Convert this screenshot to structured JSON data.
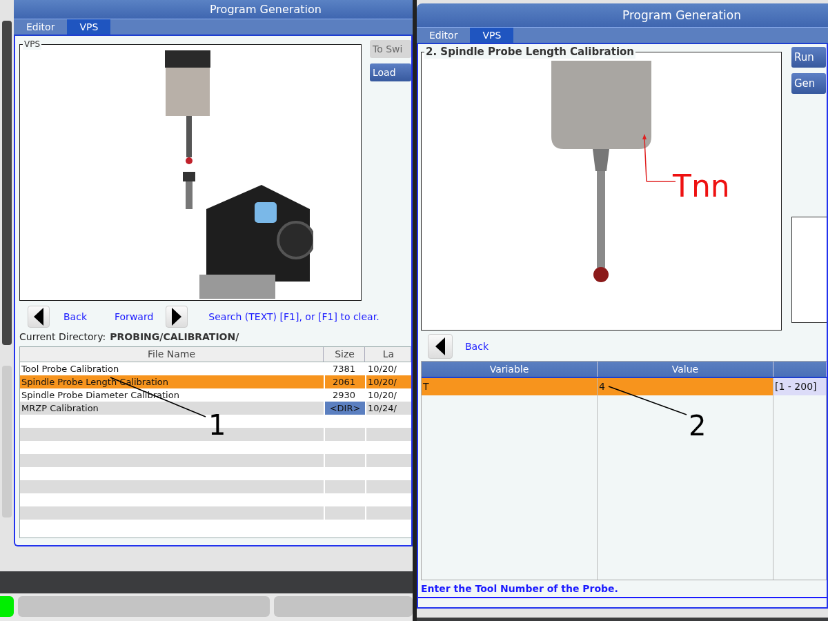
{
  "left": {
    "title": "Program Generation",
    "tabs": [
      {
        "label": "Editor",
        "selected": false
      },
      {
        "label": "VPS",
        "selected": true
      }
    ],
    "group_title": "VPS",
    "side_buttons": [
      {
        "label": "To Swi",
        "disabled": true
      },
      {
        "label": "Load",
        "disabled": false
      }
    ],
    "nav": {
      "back": "Back",
      "forward": "Forward",
      "hint": "Search (TEXT) [F1], or [F1] to clear."
    },
    "current_directory": {
      "label": "Current Directory:",
      "path": "PROBING/CALIBRATION/"
    },
    "table": {
      "columns": [
        "File Name",
        "Size",
        "La"
      ],
      "rows": [
        {
          "name": "Tool Probe Calibration",
          "size": "7381",
          "date": "10/20/",
          "kind": "file",
          "selected": false
        },
        {
          "name": "Spindle Probe Length Calibration",
          "size": "2061",
          "date": "10/20/",
          "kind": "file",
          "selected": true
        },
        {
          "name": "Spindle Probe Diameter Calibration",
          "size": "2930",
          "date": "10/20/",
          "kind": "file",
          "selected": false
        },
        {
          "name": "MRZP Calibration",
          "size": "<DIR>",
          "date": "10/24/",
          "kind": "dir",
          "selected": false
        }
      ]
    },
    "callout": "1"
  },
  "right": {
    "title": "Program Generation",
    "tabs": [
      {
        "label": "Editor",
        "selected": false
      },
      {
        "label": "VPS",
        "selected": true
      }
    ],
    "group_title": "2. Spindle Probe Length Calibration",
    "image_label": "Tnn",
    "side_buttons": [
      {
        "label": "Run",
        "disabled": false
      },
      {
        "label": "Gen",
        "disabled": false
      }
    ],
    "nav": {
      "back": "Back"
    },
    "table": {
      "columns": [
        "Variable",
        "Value"
      ],
      "rows": [
        {
          "variable": "T",
          "value": "4",
          "range": "[1 - 200]",
          "selected": true
        }
      ]
    },
    "prompt": "Enter the Tool Number of the Probe.",
    "callout": "2"
  }
}
